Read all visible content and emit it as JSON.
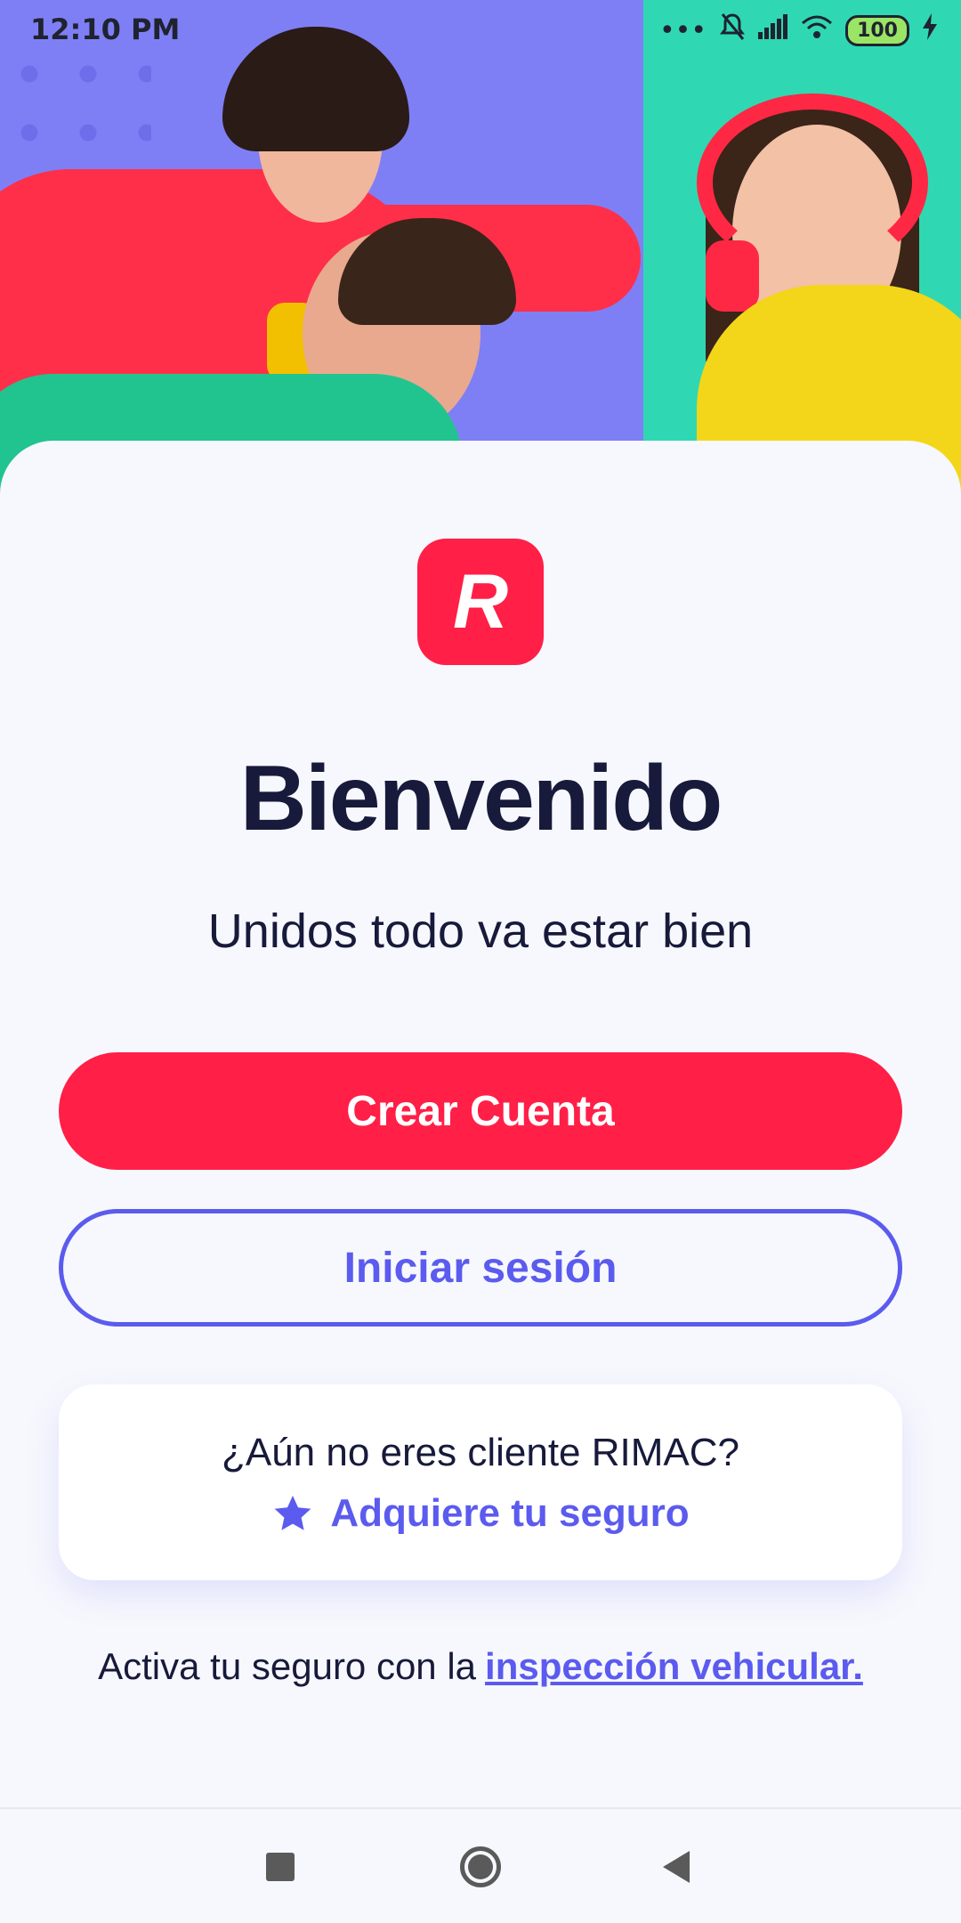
{
  "status_bar": {
    "time": "12:10 PM",
    "battery": "100"
  },
  "welcome": {
    "logo_letter": "R",
    "title": "Bienvenido",
    "subtitle": "Unidos todo va estar bien"
  },
  "actions": {
    "create_account": "Crear Cuenta",
    "sign_in": "Iniciar sesión"
  },
  "promo": {
    "question": "¿Aún no eres cliente RIMAC?",
    "link_label": "Adquiere tu seguro",
    "icon": "star-icon"
  },
  "footer": {
    "text": "Activa tu seguro con la",
    "link": "inspección vehicular."
  },
  "colors": {
    "brand_red": "#ff1f47",
    "accent_purple": "#5b5bef",
    "hero_left_bg": "#7f7ff5",
    "hero_right_bg": "#2fd8b3"
  }
}
